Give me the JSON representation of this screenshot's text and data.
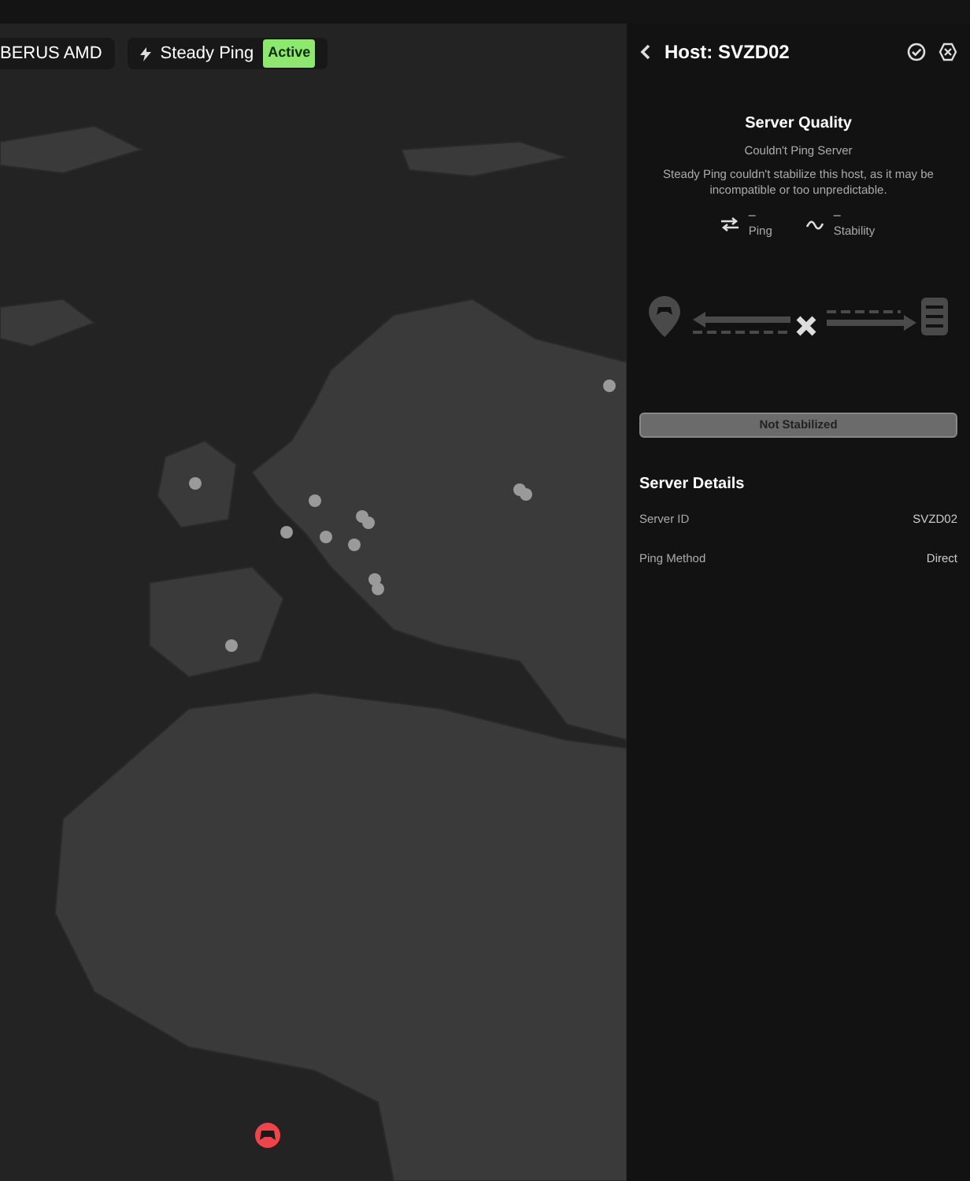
{
  "chips": [
    {
      "kind": "plain",
      "label": "BERUS AMD"
    },
    {
      "kind": "feature",
      "label": "Steady Ping",
      "badge": "Active"
    }
  ],
  "panel": {
    "title": "Host: SVZD02",
    "quality": {
      "title": "Server Quality",
      "status": "Couldn't Ping Server",
      "description": "Steady Ping couldn't stabilize this host, as it may be incompatible or too unpredictable.",
      "metrics": [
        {
          "kind": "ping",
          "value": "–",
          "label": "Ping"
        },
        {
          "kind": "stability",
          "value": "–",
          "label": "Stability"
        }
      ]
    },
    "route": {
      "connected": false
    },
    "result": "Not Stabilized",
    "details_title": "Server Details",
    "details": [
      {
        "label": "Server ID",
        "value": "SVZD02"
      },
      {
        "label": "Ping Method",
        "value": "Direct"
      }
    ]
  }
}
